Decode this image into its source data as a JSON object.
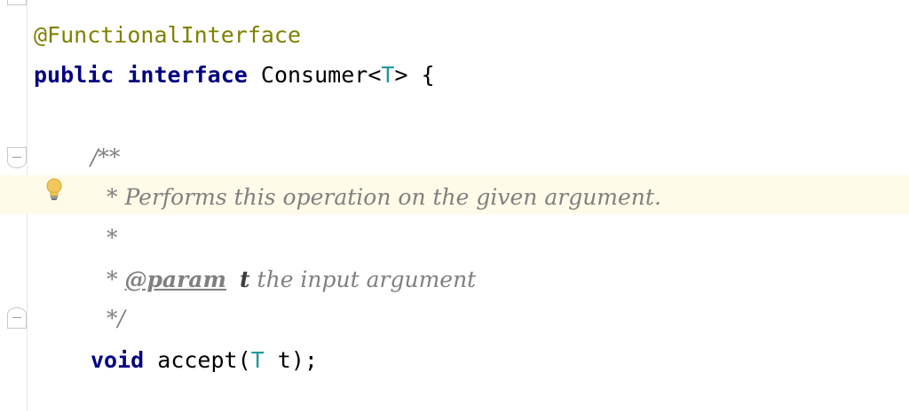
{
  "editor": {
    "annotation": "@FunctionalInterface",
    "kw_public": "public",
    "kw_interface": "interface",
    "class_name": "Consumer",
    "lt": "<",
    "type_param": "T",
    "gt": ">",
    "open_brace": " {",
    "doc_open": "/**",
    "doc_line1": "* Performs this operation on the given argument.",
    "doc_line2": "*",
    "doc_star": "* ",
    "doc_tag": "@param",
    "doc_param_name": "t",
    "doc_param_desc": " the input argument",
    "doc_close": "*/",
    "kw_void": "void",
    "method_name": "accept",
    "paren_open": "(",
    "param_type": "T",
    "param_name": " t",
    "paren_close": ");"
  },
  "icons": {
    "intention": "lightbulb-icon",
    "fold_open": "fold-open-icon",
    "fold_close": "fold-close-icon"
  },
  "colors": {
    "keyword": "#000080",
    "annotation": "#808000",
    "comment": "#808080",
    "type_param": "#20999d",
    "caret_row": "#fefbe8"
  }
}
